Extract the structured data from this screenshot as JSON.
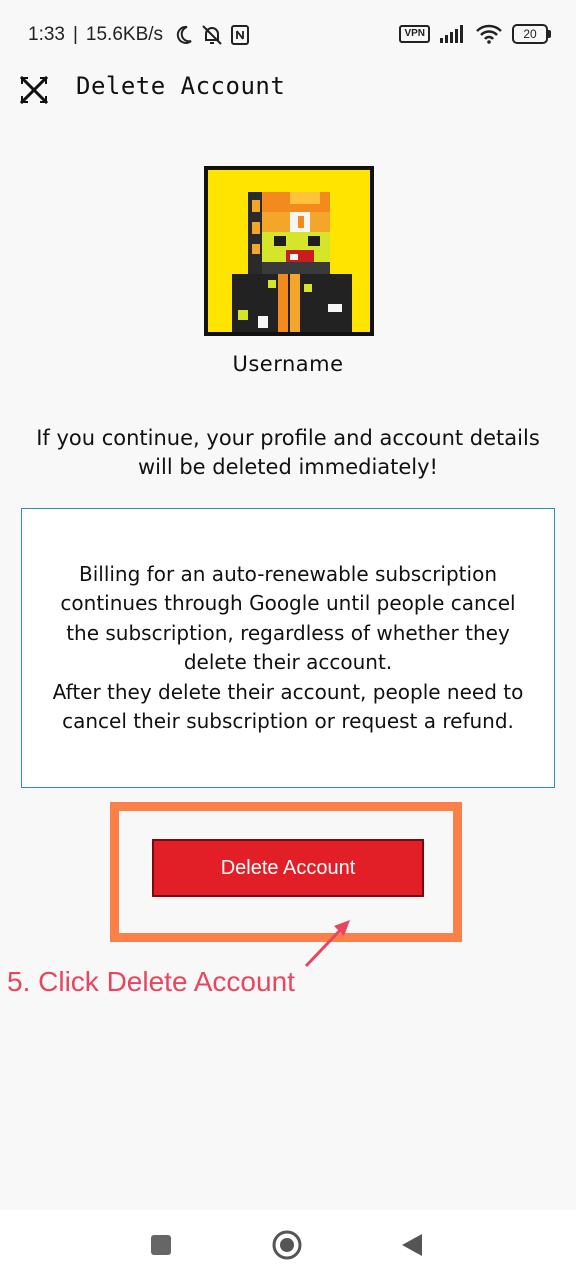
{
  "status_bar": {
    "time": "1:33",
    "separator": "|",
    "network_speed": "15.6KB/s",
    "vpn_label": "VPN",
    "battery_level": "20"
  },
  "header": {
    "title": "Delete Account"
  },
  "profile": {
    "username": "Username"
  },
  "warning_text": "If you continue, your profile and account details will be deleted immediately!",
  "billing_notice": {
    "paragraph_1": "Billing for an auto-renewable subscription continues through Google until people cancel the subscription, regardless of whether they delete their account.",
    "paragraph_2": "After they delete their account, people need to cancel their subscription or request a refund."
  },
  "delete_button_label": "Delete Account",
  "annotation_text": "5. Click Delete Account",
  "colors": {
    "button_red": "#e21f26",
    "highlight_orange": "#fa7f48",
    "annotation_pink": "#e8455e",
    "box_border_blue": "#2f8fb3",
    "avatar_background": "#ffe400"
  },
  "icons": {
    "close": "close-icon",
    "moon": "moon-icon",
    "notifications_off": "bell-off-icon",
    "nfc": "nfc-icon",
    "signal": "signal-icon",
    "wifi": "wifi-icon",
    "nav_recents": "recents-icon",
    "nav_home": "home-icon",
    "nav_back": "back-icon"
  }
}
